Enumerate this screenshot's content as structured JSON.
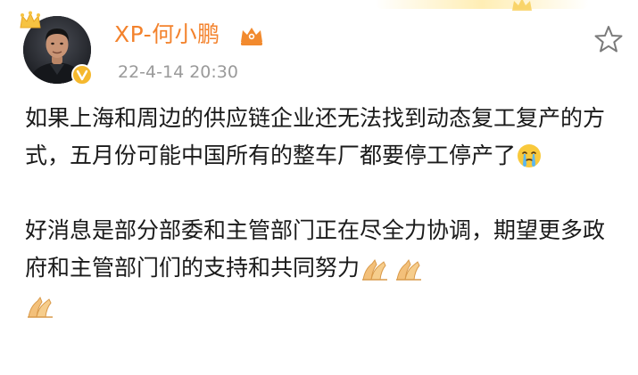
{
  "post": {
    "author": "XP-何小鹏",
    "timestamp": "22-4-14 20:30",
    "paragraphs": [
      {
        "text": "如果上海和周边的供应链企业还无法找到动态复工复产的方式，五月份可能中国所有的整车厂都要停工停产了",
        "emojis": [
          "crying-face"
        ]
      },
      {
        "text": "好消息是部分部委和主管部门正在尽全力协调，期望更多政府和主管部门们的支持和共同努力",
        "emojis": [
          "folded-hands",
          "folded-hands",
          "folded-hands"
        ]
      }
    ]
  },
  "icons": {
    "crown": "crown-icon",
    "verified": "verified-badge-icon",
    "vip": "vip-member-icon",
    "star": "star-outline-icon"
  },
  "colors": {
    "username": "#f3822c",
    "timestamp": "#9a9a9a",
    "text": "#1a1a1a",
    "badge": "#f5b82e"
  }
}
